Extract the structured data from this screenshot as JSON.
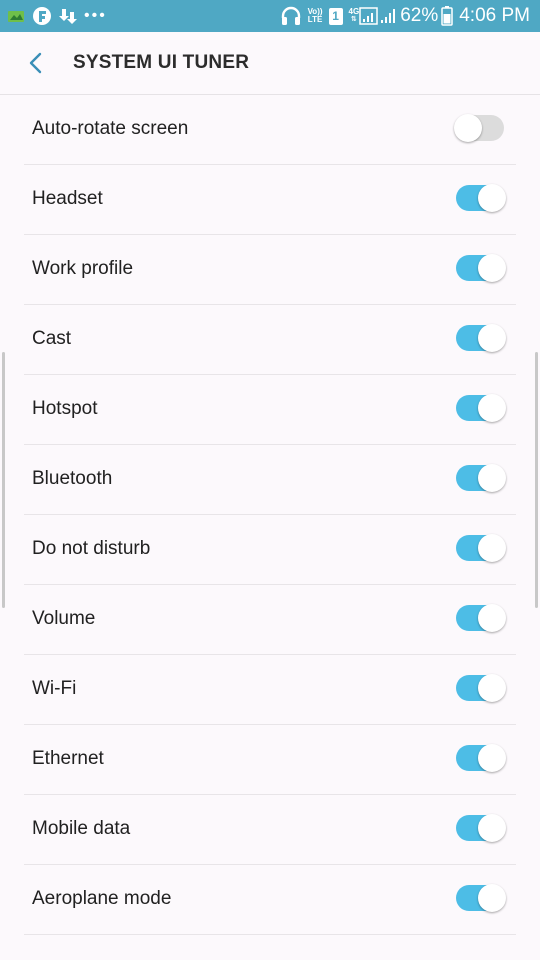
{
  "status_bar": {
    "dots": "•••",
    "volte_top": "Vo))",
    "volte_bottom": "LTE",
    "sim": "1",
    "network": "4G",
    "battery": "62%",
    "time": "4:06 PM"
  },
  "header": {
    "title": "SYSTEM UI TUNER"
  },
  "colors": {
    "status_bar": "#4fa8c4",
    "switch_on": "#4dbde6",
    "switch_off": "#dcdcdc",
    "back_icon": "#3a8fb7"
  },
  "settings": [
    {
      "label": "Auto-rotate screen",
      "enabled": false
    },
    {
      "label": "Headset",
      "enabled": true
    },
    {
      "label": "Work profile",
      "enabled": true
    },
    {
      "label": "Cast",
      "enabled": true
    },
    {
      "label": "Hotspot",
      "enabled": true
    },
    {
      "label": "Bluetooth",
      "enabled": true
    },
    {
      "label": "Do not disturb",
      "enabled": true
    },
    {
      "label": "Volume",
      "enabled": true
    },
    {
      "label": "Wi-Fi",
      "enabled": true
    },
    {
      "label": "Ethernet",
      "enabled": true
    },
    {
      "label": "Mobile data",
      "enabled": true
    },
    {
      "label": "Aeroplane mode",
      "enabled": true
    }
  ]
}
